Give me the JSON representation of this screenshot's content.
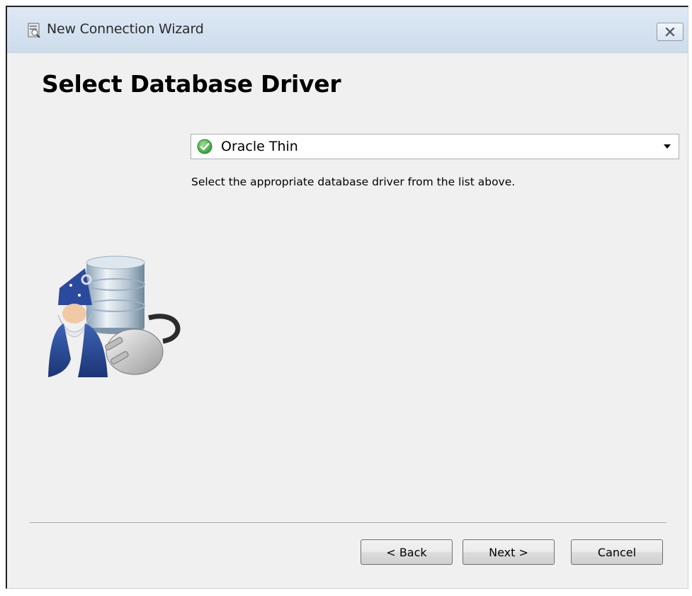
{
  "window": {
    "title": "New Connection Wizard",
    "title_icon": "database-wizard-icon",
    "close_icon": "close-icon"
  },
  "page": {
    "heading": "Select Database Driver",
    "helper_text": "Select the appropriate database driver from the list above."
  },
  "driver_select": {
    "selected_value": "Oracle Thin",
    "status_icon": "green-check-icon",
    "arrow_icon": "chevron-down-icon"
  },
  "buttons": {
    "back_label": "< Back",
    "next_label": "Next >",
    "cancel_label": "Cancel"
  },
  "colors": {
    "titlebar": "#d3e1f0",
    "dialog_bg": "#f0f0f0",
    "check_green": "#3aa83a"
  }
}
